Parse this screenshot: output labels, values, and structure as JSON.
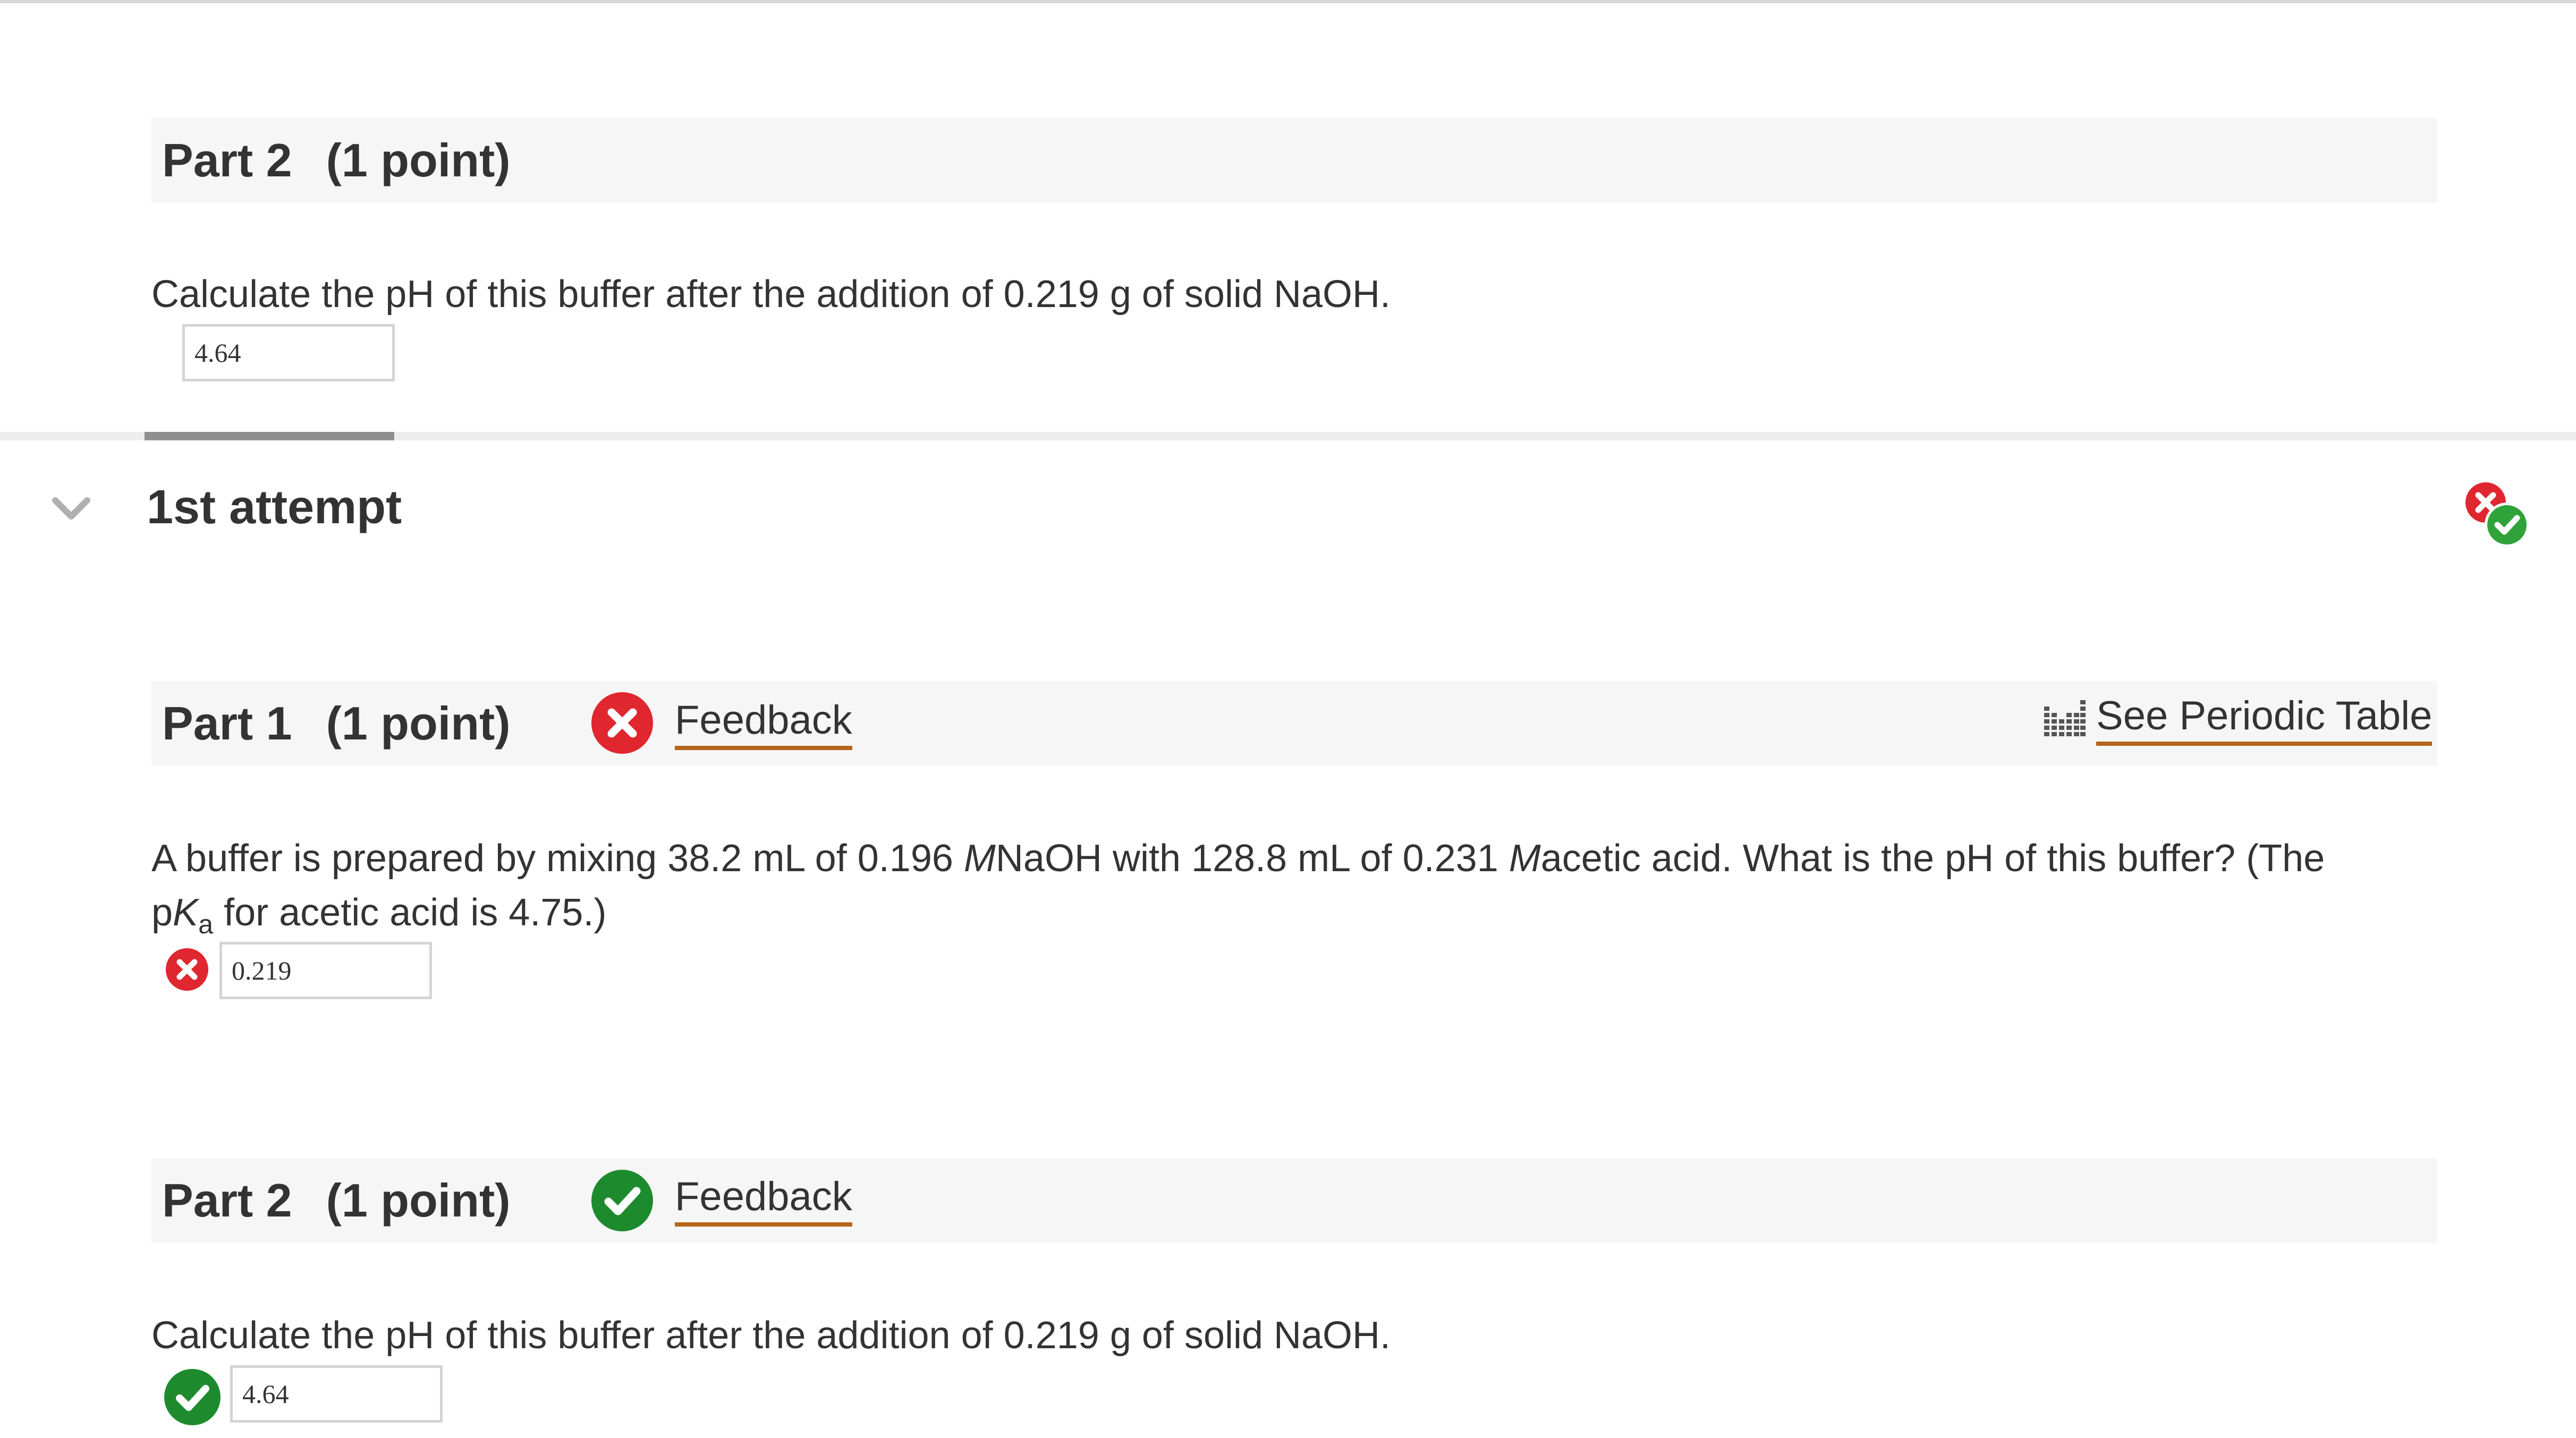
{
  "top_section": {
    "part_label": "Part 2",
    "points": "(1 point)",
    "question": "Calculate the pH of this buffer after the addition of 0.219  g of solid NaOH.",
    "answer_value": "4.64"
  },
  "attempt": {
    "title": "1st attempt",
    "score_icon": "mixed-incorrect-correct-icon"
  },
  "part1": {
    "part_label": "Part 1",
    "points": "(1 point)",
    "status": "incorrect",
    "feedback_label": "Feedback",
    "periodic_table_label": "See Periodic Table",
    "question_line1_a": "A buffer is prepared by mixing 38.2 mL of 0.196 ",
    "question_M1": "M",
    "question_line1_b": "NaOH with 128.8  mL of 0.231 ",
    "question_M2": "M",
    "question_line1_c": "acetic acid. What is the pH of this buffer? (The",
    "question_line2_p": "p",
    "question_line2_K": "K",
    "question_line2_sub": "a",
    "question_line2_rest": " for acetic acid is 4.75.)",
    "answer_value": "0.219"
  },
  "part2": {
    "part_label": "Part 2",
    "points": "(1 point)",
    "status": "correct",
    "feedback_label": "Feedback",
    "question": "Calculate the pH of this buffer after the addition of 0.219  g of solid NaOH.",
    "answer_value": "4.64"
  },
  "colors": {
    "incorrect_red": "#e0262f",
    "correct_green": "#1e8a2e",
    "link_underline": "#b5651d",
    "header_bg": "#f6f6f6"
  }
}
